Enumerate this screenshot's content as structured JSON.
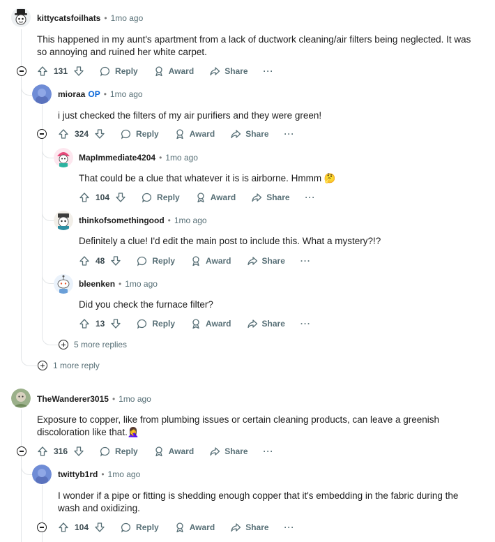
{
  "comments": [
    {
      "author": "kittycatsfoilhats",
      "time": "1mo ago",
      "body": "This happened in my aunt's apartment from a lack of ductwork cleaning/air filters being neglected. It was so annoying and ruined her white carpet.",
      "votes": "131"
    },
    {
      "author": "mioraa",
      "op": "OP",
      "time": "1mo ago",
      "body": "i just checked the filters of my air purifiers and they were green!",
      "votes": "324"
    },
    {
      "author": "MapImmediate4204",
      "time": "1mo ago",
      "body": "That could be a clue that whatever it is is airborne. Hmmm 🤔",
      "votes": "104"
    },
    {
      "author": "thinkofsomethingood",
      "time": "1mo ago",
      "body": "Definitely a clue! I'd edit the main post to include this. What a mystery?!?",
      "votes": "48"
    },
    {
      "author": "bleenken",
      "time": "1mo ago",
      "body": "Did you check the furnace filter?",
      "votes": "13"
    },
    {
      "author": "TheWanderer3015",
      "time": "1mo ago",
      "body": "Exposure to copper, like from plumbing issues or certain cleaning products, can leave a greenish discoloration like that.🤦‍♀️",
      "votes": "316"
    },
    {
      "author": "twittyb1rd",
      "time": "1mo ago",
      "body": "I wonder if a pipe or fitting is shedding enough copper that it's embedding in the fabric during the wash and oxidizing.",
      "votes": "104"
    }
  ],
  "actions": {
    "reply": "Reply",
    "award": "Award",
    "share": "Share",
    "more": "···"
  },
  "separator": "•",
  "more_replies": {
    "nested": "5 more replies",
    "top": "1 more reply"
  },
  "colors": {
    "text": "#1c1c1c",
    "meta": "#576f76",
    "op": "#0a66d8",
    "thread": "#e3e6e8"
  }
}
